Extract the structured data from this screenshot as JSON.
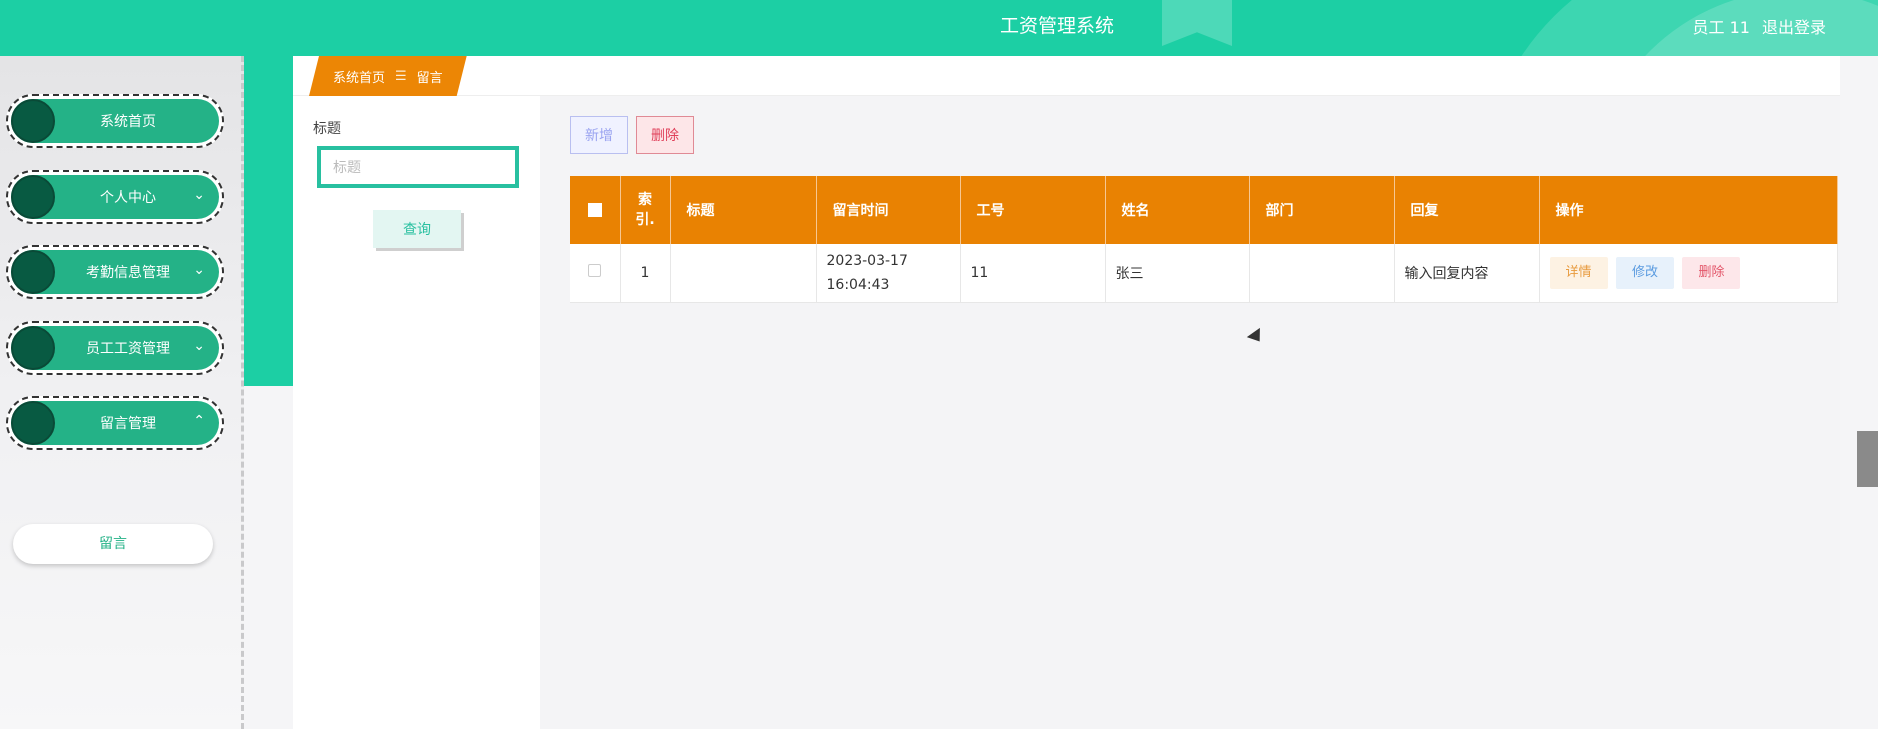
{
  "app": {
    "title": "工资管理系统"
  },
  "user": {
    "name": "员工 11",
    "logout": "退出登录"
  },
  "sidebar": {
    "items": [
      {
        "label": "系统首页",
        "arrow": ""
      },
      {
        "label": "个人中心",
        "arrow": "⌄"
      },
      {
        "label": "考勤信息管理",
        "arrow": "⌄"
      },
      {
        "label": "员工工资管理",
        "arrow": "⌄"
      },
      {
        "label": "留言管理",
        "arrow": "⌃"
      }
    ],
    "submenu": {
      "label": "留言"
    }
  },
  "breadcrumb": {
    "home": "系统首页",
    "separator": "☰",
    "current": "留言"
  },
  "search": {
    "label": "标题",
    "placeholder": "标题",
    "value": "",
    "button": "查询"
  },
  "toolbar": {
    "add": "新增",
    "delete": "删除"
  },
  "table": {
    "headers": [
      "索引",
      "标题",
      "留言时间",
      "工号",
      "姓名",
      "部门",
      "回复",
      "操作"
    ],
    "index_header": "索\n引.",
    "rows": [
      {
        "index": "1",
        "title": "",
        "time": "2023-03-17 16:04:43",
        "empno": "11",
        "name": "张三",
        "dept": "",
        "reply": "输入回复内容"
      }
    ],
    "actions": {
      "detail": "详情",
      "edit": "修改",
      "delete": "删除"
    }
  },
  "colors": {
    "primary": "#1ccfa4",
    "header_orange": "#e98202",
    "menu_green": "#24b287",
    "dot_dark": "#085a42"
  }
}
